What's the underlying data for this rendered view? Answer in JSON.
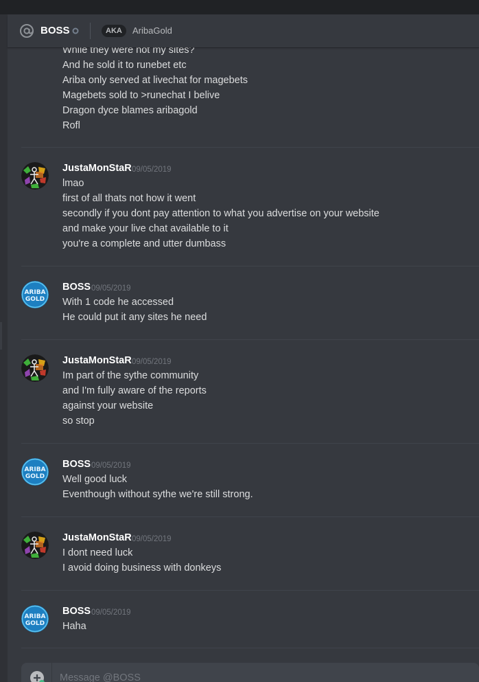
{
  "header": {
    "name": "BOSS",
    "aka_label": "AKA",
    "alias": "AribaGold",
    "icons": {
      "at": "at-icon",
      "status": "offline-status-icon"
    }
  },
  "messages": {
    "m0": {
      "lines": [
        "While they were not my sites?",
        "And he sold it to runebet etc",
        "Ariba only served at livechat for magebets",
        "Magebets sold to >runechat I belive",
        "Dragon dyce blames aribagold",
        "Rofl"
      ]
    },
    "m1": {
      "author": "JustaMonStaR",
      "timestamp": "09/05/2019",
      "lines": [
        "lmao",
        "first of all thats not how it went",
        "secondly if you dont pay attention to what you advertise on your website",
        "and make your live chat available to it",
        "you're a complete and utter dumbass"
      ]
    },
    "m2": {
      "author": "BOSS",
      "timestamp": "09/05/2019",
      "lines": [
        "With 1 code he accessed",
        "He could put it any sites he need"
      ]
    },
    "m3": {
      "author": "JustaMonStaR",
      "timestamp": "09/05/2019",
      "lines": [
        "Im part of the sythe community",
        "and I'm fully aware of the reports",
        "against your website",
        "so stop"
      ]
    },
    "m4": {
      "author": "BOSS",
      "timestamp": "09/05/2019",
      "lines": [
        "Well good luck",
        "Eventhough without sythe we're still strong."
      ]
    },
    "m5": {
      "author": "JustaMonStaR",
      "timestamp": "09/05/2019",
      "lines": [
        "I dont need luck",
        "I avoid doing business with donkeys"
      ]
    },
    "m6": {
      "author": "BOSS",
      "timestamp": "09/05/2019",
      "lines": [
        "Haha"
      ]
    }
  },
  "avatars": {
    "boss_text_top": "ARIBA",
    "boss_text_bottom": "GOLD"
  },
  "composer": {
    "placeholder": "Message @BOSS",
    "icon": "add-circle-icon"
  },
  "colors": {
    "background": "#36393f",
    "username": "#ffffff",
    "message_text": "#dcddde",
    "timestamp": "#72767d",
    "boss_avatar": "#1d7fc1"
  }
}
